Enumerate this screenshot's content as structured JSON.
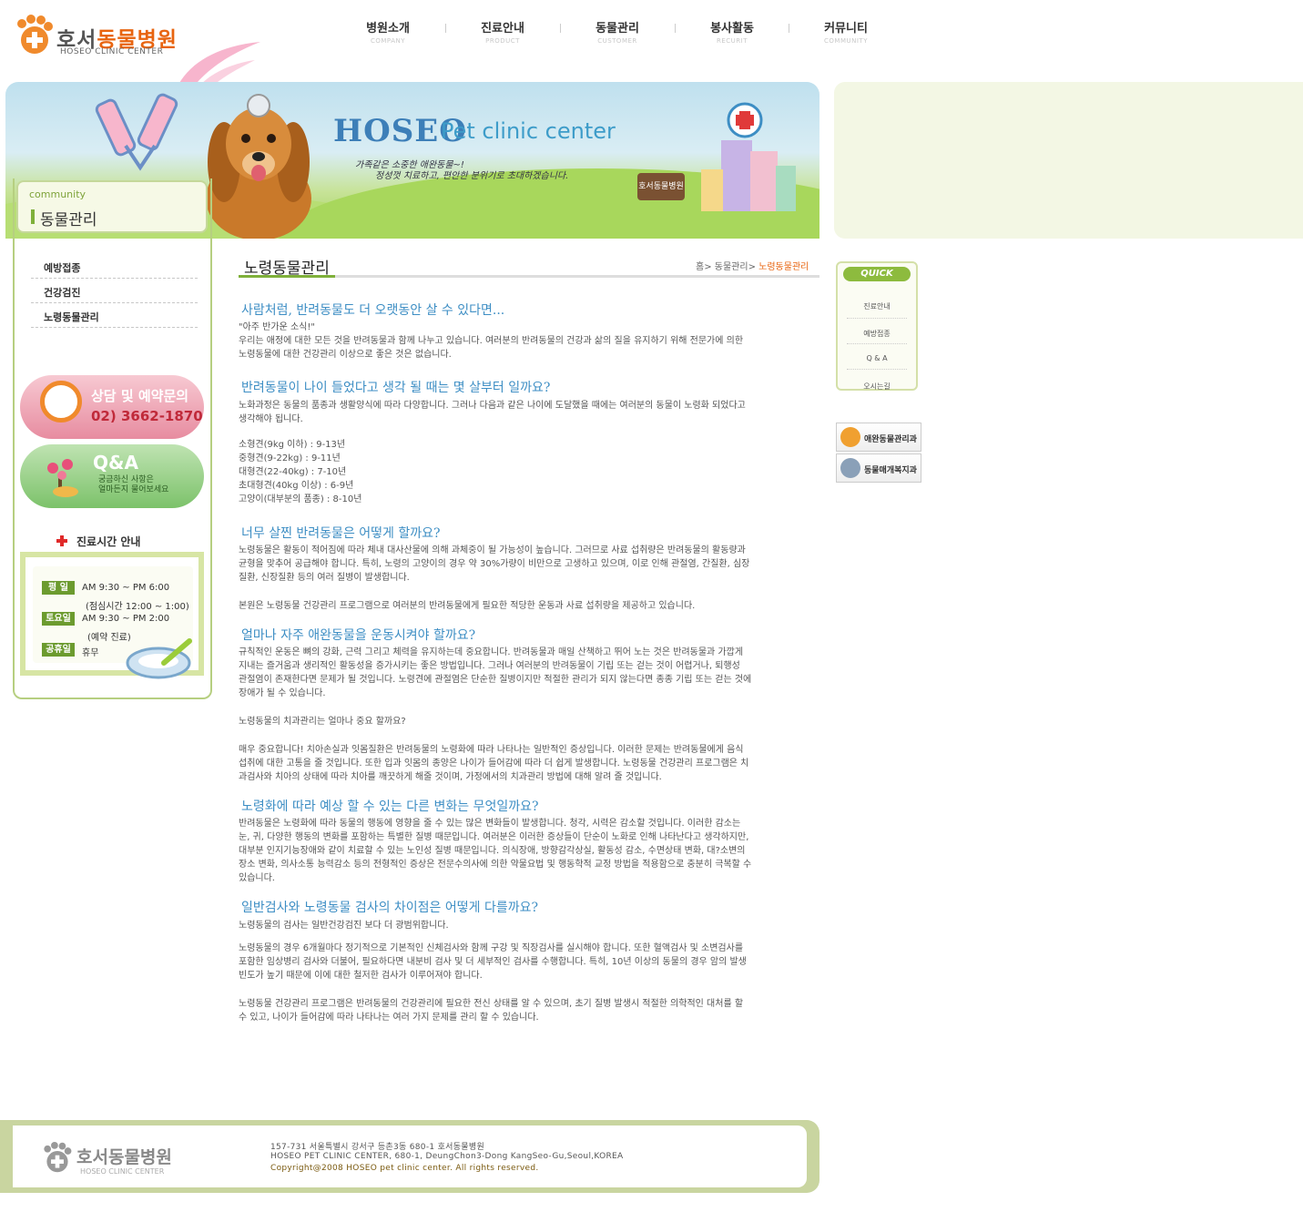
{
  "logo": {
    "name_part1": "호서",
    "name_part2": "동물병원",
    "sub": "HOSEO CLINIC CENTER"
  },
  "gnb": [
    {
      "ko": "병원소개",
      "en": "COMPANY"
    },
    {
      "ko": "진료안내",
      "en": "PRODUCT"
    },
    {
      "ko": "동물관리",
      "en": "CUSTOMER"
    },
    {
      "ko": "봉사활동",
      "en": "RECURIT"
    },
    {
      "ko": "커뮤니티",
      "en": "COMMUNITY"
    }
  ],
  "banner": {
    "title1": "HOSEO",
    "title2": "Pet clinic center",
    "sub1": "가족같은 소중한 애완동물~!",
    "sub2": "정성껏 치료하고, 편안한 분위기로 초대하겠습니다.",
    "sign": "호서동물병원"
  },
  "section": {
    "en": "community",
    "ko": "동물관리"
  },
  "lnb": [
    "예방접종",
    "건강검진",
    "노령동물관리"
  ],
  "promo_phone": {
    "title": "상담 및 예약문의",
    "phone": "02) 3662-1870"
  },
  "promo_qa": {
    "title": "Q&A",
    "line1": "궁금하신 사항은",
    "line2": "얼마든지 물어보세요"
  },
  "hours": {
    "title": "진료시간 안내",
    "rows": [
      {
        "day": "평 일",
        "time": "AM 9:30 ~ PM 6:00"
      },
      {
        "day": "",
        "time": "(점심시간 12:00 ~ 1:00)"
      },
      {
        "day": "토요일",
        "time": "AM 9:30 ~ PM 2:00"
      },
      {
        "day": "",
        "time": "(예약 진료)"
      },
      {
        "day": "공휴일",
        "time": "휴무"
      }
    ]
  },
  "content": {
    "title": "노령동물관리",
    "breadcrumb": {
      "home": "홈",
      "sep1": "> 동물관리",
      "sep2": ">",
      "current": "노령동물관리"
    },
    "blocks": [
      {
        "type": "h",
        "text": "사람처럼, 반려동물도 더 오랫동안 살 수 있다면..."
      },
      {
        "type": "p",
        "lines": [
          "\"아주 반가운 소식!\"",
          "우리는 애정에 대한 모든 것을 반려동물과 함께 나누고 있습니다. 여러분의 반려동물의 건강과 삶의 질을 유지하기 위해 전문가에 의한",
          "노령동물에 대한 건강관리 이상으로 좋은 것은 없습니다."
        ]
      },
      {
        "type": "h",
        "text": "반려동물이 나이 들었다고 생각 될 때는 몇 살부터 일까요?"
      },
      {
        "type": "p",
        "lines": [
          "노화과정은 동물의 품종과 생활양식에 따라 다양합니다. 그러나 다음과 같은 나이에 도달했을 때에는 여러분의 동물이 노령화 되었다고",
          "생각해야 됩니다."
        ]
      },
      {
        "type": "p",
        "lines": [
          "소형견(9kg 이하) : 9-13년",
          "중형견(9-22kg) : 9-11년",
          "대형견(22-40kg) : 7-10년",
          "초대형견(40kg 이상) : 6-9년",
          "고양이(대부분의 품종) : 8-10년"
        ]
      },
      {
        "type": "h",
        "text": "너무 살찐 반려동물은 어떻게 할까요?"
      },
      {
        "type": "p",
        "lines": [
          "노령동물은 활동이 적어짐에 따라 체내 대사산물에 의해 과체중이 될 가능성이 높습니다. 그러므로 사료 섭취량은 반려동물의 활동량과",
          "균형을 맞추어 공급해야 합니다. 특히, 노령의 고양이의 경우 약 30%가량이 비만으로 고생하고 있으며, 이로 인해 관절염, 간질환, 심장",
          "질환, 신장질환 등의 여러 질병이 발생합니다."
        ]
      },
      {
        "type": "p",
        "lines": [
          "본원은 노령동물 건강관리 프로그램으로 여러분의 반려동물에게 필요한 적당한 운동과 사료 섭취량을 제공하고 있습니다."
        ]
      },
      {
        "type": "h",
        "text": "얼마나 자주 애완동물을 운동시켜야 할까요?"
      },
      {
        "type": "p",
        "lines": [
          "규칙적인 운동은 뼈의 강화, 근력 그리고 체력을 유지하는데 중요합니다. 반려동물과 매일 산책하고 뛰어 노는 것은 반려동물과 가깝게",
          "지내는 즐거움과 생리적인 활동성을 증가시키는 좋은 방법입니다. 그러나 여러분의 반려동물이 기립 또는 걷는 것이 어렵거나, 퇴행성",
          "관절염이 존재한다면 문제가 될 것입니다. 노령견에 관절염은 단순한 질병이지만 적절한 관리가 되지 않는다면 종종 기립 또는 걷는 것에",
          "장애가 될 수 있습니다."
        ]
      },
      {
        "type": "p",
        "lines": [
          "노령동물의 치과관리는 얼마나 중요 할까요?"
        ]
      },
      {
        "type": "p",
        "lines": [
          "매우 중요합니다! 치아손실과 잇몸질환은 반려동물의 노령화에 따라 나타나는 일반적인 증상입니다. 이러한 문제는 반려동물에게 음식",
          "섭취에 대한 고통을 줄 것입니다. 또한 입과 잇몸의 종양은 나이가 들어감에 따라 더 쉽게 발생합니다. 노령동물 건강관리 프로그램은 치",
          "과검사와 치아의 상태에 따라 치아를 깨끗하게 해줄 것이며, 가정에서의 치과관리 방법에 대해 알려 줄 것입니다."
        ]
      },
      {
        "type": "h",
        "text": "노령화에 따라 예상 할 수 있는 다른 변화는 무엇일까요?"
      },
      {
        "type": "p",
        "lines": [
          "반려동물은 노령화에 따라 동물의 행동에 영향을 줄 수 있는 많은 변화들이 발생합니다. 청각, 시력은 감소할 것입니다. 이러한 감소는",
          "눈, 귀, 다양한 행동의 변화를 포함하는 특별한 질병 때문입니다. 여러분은 이러한 증상들이 단순이 노화로 인해 나타난다고 생각하지만,",
          "대부분 인지기능장애와 같이 치료할 수 있는 노인성 질병 때문입니다. 의식장애, 방향감각상실, 활동성 감소, 수면상태 변화, 대?소변의",
          "장소 변화, 의사소통 능력감소 등의 전형적인 증상은 전문수의사에 의한 약물요법 및 행동학적 교정 방법을 적용함으로 충분히 극복할 수",
          "있습니다."
        ]
      },
      {
        "type": "h",
        "text": "일반검사와 노령동물 검사의 차이점은 어떻게 다를까요?"
      },
      {
        "type": "p",
        "lines": [
          "노령동물의 검사는 일반건강검진 보다 더 광범위합니다."
        ]
      },
      {
        "type": "p",
        "lines": [
          "노령동물의 경우 6개월마다 정기적으로 기본적인 신체검사와 함께 구강 및 직장검사를 실시해야 합니다. 또한 혈액검사 및 소변검사를",
          "포함한 임상병리 검사와 더불어, 필요하다면 내분비 검사 및 더 세부적인 검사를 수행합니다. 특히, 10년 이상의 동물의 경우 암의 발생",
          "빈도가 높기 때문에 이에 대한 철저한 검사가 이루어져야 합니다."
        ]
      },
      {
        "type": "p",
        "lines": [
          "노령동물 건강관리 프로그램은 반려동물의 건강관리에 필요한 전신 상태를 알 수 있으며, 초기 질병 발생시 적절한 의학적인 대처를 할",
          "수 있고, 나이가 들어감에 따라 나타나는 여러 가지 문제를 관리 할 수 있습니다."
        ]
      }
    ]
  },
  "quick": {
    "head": "QUICK",
    "items": [
      "진료안내",
      "예방접종",
      "Q & A",
      "오시는길"
    ]
  },
  "quick_buttons": [
    "애완동물관리과",
    "동물매개복지과"
  ],
  "footer": {
    "logo_ko": "호서동물병원",
    "logo_en": "HOSEO CLINIC CENTER",
    "addr1": "157-731 서울특별시 강서구 등촌3동 680-1 호서동물병원",
    "addr2": "HOSEO PET CLINIC CENTER, 680-1, DeungChon3-Dong KangSeo-Gu,Seoul,KOREA",
    "copy": "Copyright@2008 HOSEO pet clinic center. All rights reserved."
  }
}
